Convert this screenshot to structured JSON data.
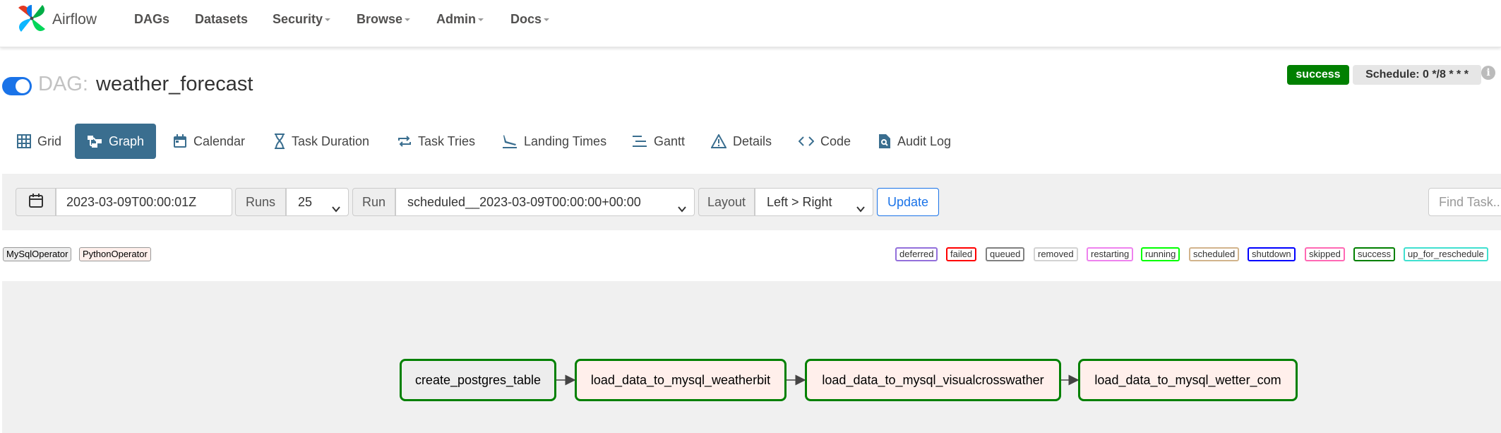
{
  "navbar": {
    "brand": "Airflow",
    "items": [
      {
        "label": "DAGs",
        "dropdown": false
      },
      {
        "label": "Datasets",
        "dropdown": false
      },
      {
        "label": "Security",
        "dropdown": true
      },
      {
        "label": "Browse",
        "dropdown": true
      },
      {
        "label": "Admin",
        "dropdown": true
      },
      {
        "label": "Docs",
        "dropdown": true
      }
    ]
  },
  "dag": {
    "prefix": "DAG:",
    "name": "weather_forecast",
    "paused": false,
    "status_badge": "success",
    "schedule": "Schedule: 0 */8 * * *",
    "info_icon": "i"
  },
  "tabs": [
    {
      "label": "Grid",
      "icon": "grid-icon",
      "active": false
    },
    {
      "label": "Graph",
      "icon": "graph-icon",
      "active": true
    },
    {
      "label": "Calendar",
      "icon": "calendar-icon",
      "active": false
    },
    {
      "label": "Task Duration",
      "icon": "hourglass-icon",
      "active": false
    },
    {
      "label": "Task Tries",
      "icon": "repeat-icon",
      "active": false
    },
    {
      "label": "Landing Times",
      "icon": "plane-landing-icon",
      "active": false
    },
    {
      "label": "Gantt",
      "icon": "gantt-icon",
      "active": false
    },
    {
      "label": "Details",
      "icon": "warning-triangle-icon",
      "active": false
    },
    {
      "label": "Code",
      "icon": "code-icon",
      "active": false
    },
    {
      "label": "Audit Log",
      "icon": "file-search-icon",
      "active": false
    }
  ],
  "toolbar": {
    "base_date": "2023-03-09T00:00:01Z",
    "runs_label": "Runs",
    "runs_value": "25",
    "run_label": "Run",
    "run_value": "scheduled__2023-03-09T00:00:00+00:00",
    "layout_label": "Layout",
    "layout_value": "Left > Right",
    "update_label": "Update",
    "find_placeholder": "Find Task..."
  },
  "operators": [
    {
      "label": "MySqlOperator",
      "bg": "#ededed"
    },
    {
      "label": "PythonOperator",
      "bg": "#ffefeb"
    }
  ],
  "states": [
    {
      "label": "deferred",
      "color": "#9370db"
    },
    {
      "label": "failed",
      "color": "#ff0000"
    },
    {
      "label": "queued",
      "color": "#808080"
    },
    {
      "label": "removed",
      "color": "#d3d3d3"
    },
    {
      "label": "restarting",
      "color": "#ee82ee"
    },
    {
      "label": "running",
      "color": "#00ff00"
    },
    {
      "label": "scheduled",
      "color": "#d2b48c"
    },
    {
      "label": "shutdown",
      "color": "#0000ff"
    },
    {
      "label": "skipped",
      "color": "#ff69b4"
    },
    {
      "label": "success",
      "color": "#008000"
    },
    {
      "label": "up_for_reschedule",
      "color": "#40e0d0"
    }
  ],
  "graph": {
    "tasks": [
      {
        "label": "create_postgres_table",
        "bg": "#ededed"
      },
      {
        "label": "load_data_to_mysql_weatherbit",
        "bg": "#ffefeb"
      },
      {
        "label": "load_data_to_mysql_visualcrosswather",
        "bg": "#ffefeb"
      },
      {
        "label": "load_data_to_mysql_wetter_com",
        "bg": "#ffefeb"
      }
    ],
    "node_border_color": "#008000"
  },
  "colors": {
    "accent": "#1a73e8",
    "active_tab": "#3a6e8f",
    "success": "#008000",
    "toolbar_bg": "#f0f0f0"
  }
}
